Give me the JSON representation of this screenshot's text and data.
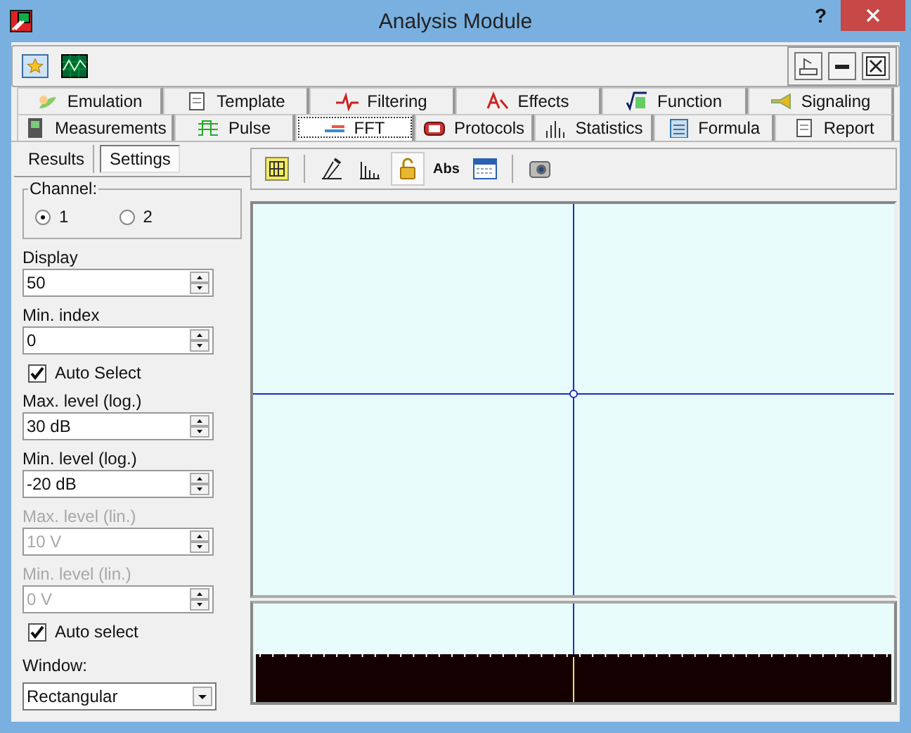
{
  "window": {
    "title": "Analysis Module",
    "help": "?"
  },
  "tabs_row1": [
    {
      "label": "Emulation",
      "selected": false
    },
    {
      "label": "Template",
      "selected": false
    },
    {
      "label": "Filtering",
      "selected": false
    },
    {
      "label": "Effects",
      "selected": false
    },
    {
      "label": "Function",
      "selected": false
    },
    {
      "label": "Signaling",
      "selected": false
    }
  ],
  "tabs_row2": [
    {
      "label": "Measurements",
      "selected": false
    },
    {
      "label": "Pulse",
      "selected": false
    },
    {
      "label": "FFT",
      "selected": true
    },
    {
      "label": "Protocols",
      "selected": false
    },
    {
      "label": "Statistics",
      "selected": false
    },
    {
      "label": "Formula",
      "selected": false
    },
    {
      "label": "Report",
      "selected": false
    }
  ],
  "side_tabs": [
    {
      "label": "Results",
      "selected": false
    },
    {
      "label": "Settings",
      "selected": true
    }
  ],
  "channel": {
    "label": "Channel:",
    "options": [
      {
        "label": "1",
        "selected": true
      },
      {
        "label": "2",
        "selected": false
      }
    ]
  },
  "fields": [
    {
      "kind": "spin",
      "label": "Display",
      "value": "50",
      "disabled": false
    },
    {
      "kind": "spin",
      "label": "Min. index",
      "value": "0",
      "disabled": false
    },
    {
      "kind": "check",
      "label": "Auto Select",
      "checked": true
    },
    {
      "kind": "spin",
      "label": "Max. level (log.)",
      "value": "30 dB",
      "disabled": false
    },
    {
      "kind": "spin",
      "label": "Min. level (log.)",
      "value": "-20 dB",
      "disabled": false
    },
    {
      "kind": "spin",
      "label": "Max. level (lin.)",
      "value": "10 V",
      "disabled": true
    },
    {
      "kind": "spin",
      "label": "Min. level (lin.)",
      "value": "0 V",
      "disabled": true
    },
    {
      "kind": "check",
      "label": "Auto select",
      "checked": true
    },
    {
      "kind": "select",
      "label": "Window:",
      "value": "Rectangular"
    }
  ],
  "plot_tools": [
    {
      "kind": "icon",
      "pressed": false
    },
    {
      "kind": "sep"
    },
    {
      "kind": "icon",
      "pressed": false
    },
    {
      "kind": "icon",
      "pressed": false
    },
    {
      "kind": "icon",
      "pressed": true
    },
    {
      "kind": "text",
      "label": "Abs",
      "pressed": false
    },
    {
      "kind": "icon",
      "pressed": false
    },
    {
      "kind": "sep"
    },
    {
      "kind": "icon",
      "pressed": false
    }
  ]
}
